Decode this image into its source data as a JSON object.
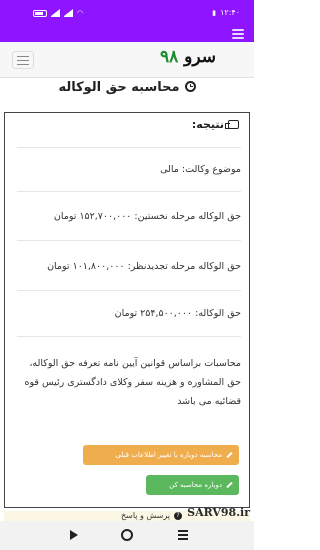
{
  "status_bar": {
    "time": "۱۲:۴۰"
  },
  "navbar": {
    "brand": "سرو",
    "brand_number": "۹۸"
  },
  "page": {
    "title": "محاسبه حق الوکاله"
  },
  "result": {
    "heading": "نتیجه:",
    "subject": "موضوع وکالت: مالی",
    "first_stage_fee": "حق الوکاله مرحله نخستین: ۱۵۲,۷۰۰,۰۰۰ تومان",
    "appeal_stage_fee": "حق الوکاله مرحله تجدیدنظر: ۱۰۱,۸۰۰,۰۰۰ تومان",
    "total_fee": "حق الوکاله: ۲۵۴,۵۰۰,۰۰۰ تومان",
    "note": "محاسبات براساس قوانین آیین نامه تعرفه حق الوکاله، حق المشاوره و هزینه سفر وکلای دادگستری رئیس قوه قضائیه می باشد"
  },
  "buttons": {
    "recalc_with_changes": "محاسبه دوباره با تغییر اطلاعات قبلی",
    "recalc": "دوباره محاسبه کن"
  },
  "faq": {
    "label": "پرسش و پاسخ"
  },
  "watermark": "SARV98.ir",
  "icons": {
    "menu": "menu-icon",
    "clock": "clock-icon",
    "result": "hand-point-icon",
    "pencil": "pencil-icon",
    "question": "question-circle-icon"
  },
  "colors": {
    "accent": "#8f14ff",
    "brand_number": "#1c8c2c",
    "warning": "#f0ad4e",
    "success": "#5cb85c"
  }
}
